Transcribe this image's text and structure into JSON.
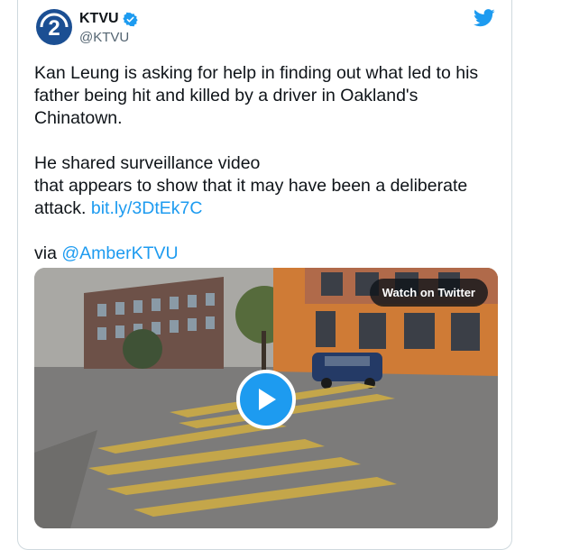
{
  "tweet": {
    "author_name": "KTVU",
    "author_handle": "@KTVU",
    "verified": true,
    "text_para1": "Kan Leung is asking for help in finding out what led to his father being hit and killed by a driver in Oakland's Chinatown.",
    "text_para2_line1": "He shared surveillance video",
    "text_para2_line2": "that appears to show that it may have been a deliberate attack.",
    "link": "bit.ly/3DtEk7C",
    "via_prefix": "via",
    "via_mention": "@AmberKTVU"
  },
  "media": {
    "watch_label": "Watch on Twitter"
  },
  "icons": {
    "avatar": "ktvu-logo-icon",
    "verified": "verified-badge-icon",
    "brand": "twitter-bird-icon",
    "play": "play-icon"
  },
  "colors": {
    "link": "#1d9bf0",
    "twitter_blue": "#1d9bf0",
    "text": "#0f1419",
    "secondary": "#536471"
  }
}
